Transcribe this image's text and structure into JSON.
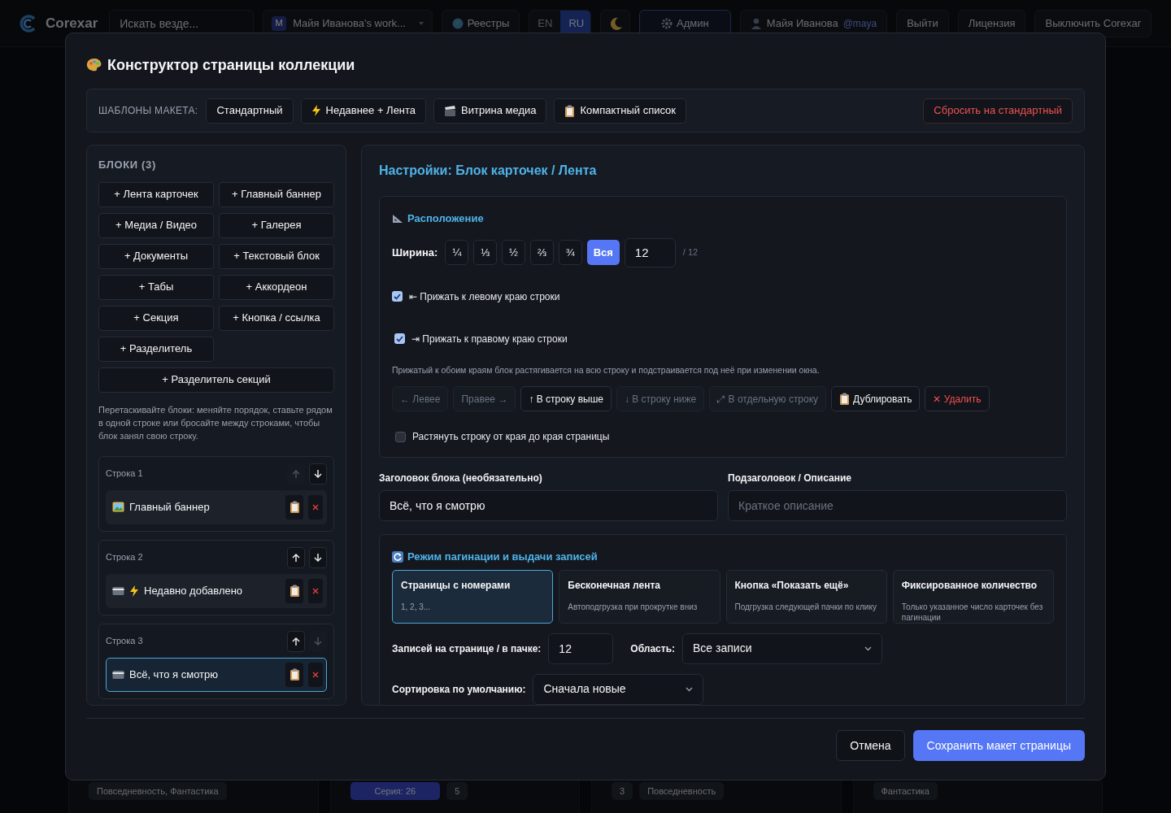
{
  "topbar": {
    "logo": "Corexar",
    "search": {
      "placeholder": "Искать везде..."
    },
    "workspace": {
      "avatar": "M",
      "label": "Майя Иванова's work..."
    },
    "registry": "Реестры",
    "languages": [
      {
        "label": "EN",
        "selected": false
      },
      {
        "label": "RU",
        "selected": true
      }
    ],
    "admin": {
      "label": "Админ",
      "selected": true
    },
    "user": {
      "name": "Майя Иванова",
      "handle": "@maya"
    },
    "buttons": [
      "Выйти",
      "Лицензия",
      "Выключить Corexar"
    ]
  },
  "background_cards": [
    {
      "tags": [
        {
          "label": "Повседневность, Фантастика",
          "selected": false
        }
      ]
    },
    {
      "tags": [
        {
          "label": "Серия: 26",
          "selected": true
        },
        {
          "label": "5",
          "selected": false
        }
      ]
    },
    {
      "tags": [
        {
          "label": "3",
          "selected": false
        },
        {
          "label": "Повседневность",
          "selected": false
        }
      ]
    },
    {
      "tags": [
        {
          "label": "Фантастика",
          "selected": false
        }
      ]
    }
  ],
  "modal": {
    "title": "Конструктор страницы коллекции",
    "templates": {
      "label": "ШАБЛОНЫ МАКЕТА:",
      "items": [
        {
          "kind": "plain",
          "label": "Стандартный"
        },
        {
          "kind": "bolt",
          "label": "Недавнее + Лента"
        },
        {
          "kind": "clapper",
          "label": "Витрина медиа"
        },
        {
          "kind": "clipboard",
          "label": "Компактный список"
        }
      ],
      "reset": "Сбросить на стандартный"
    },
    "blocks": {
      "title": "БЛОКИ (3)",
      "palette": [
        {
          "label": "+ Лента карточек",
          "kind": "half"
        },
        {
          "label": "+ Главный баннер",
          "kind": "half"
        },
        {
          "label": "+ Медиа / Видео",
          "kind": "half"
        },
        {
          "label": "+ Галерея",
          "kind": "half"
        },
        {
          "label": "+ Документы",
          "kind": "half"
        },
        {
          "label": "+ Текстовый блок",
          "kind": "half"
        },
        {
          "label": "+ Табы",
          "kind": "half"
        },
        {
          "label": "+ Аккордеон",
          "kind": "half"
        },
        {
          "label": "+ Секция",
          "kind": "half"
        },
        {
          "label": "+ Кнопка / ссылка",
          "kind": "half"
        },
        {
          "label": "+ Разделитель",
          "kind": "half"
        },
        {
          "label": "+ Разделитель секций",
          "kind": "wide"
        }
      ],
      "hint": "Перетаскивайте блоки: меняйте порядок, ставьте рядом в одной строке или бросайте между строками, чтобы блок занял свою строку.",
      "rows": [
        {
          "label": "Строка 1",
          "up_disabled": true,
          "down_disabled": false,
          "blocks": [
            {
              "kind": "banner",
              "label": "Главный баннер",
              "selected": false
            }
          ]
        },
        {
          "label": "Строка 2",
          "up_disabled": false,
          "down_disabled": false,
          "blocks": [
            {
              "kind": "recent",
              "label": "Недавно добавлено",
              "selected": false
            }
          ]
        },
        {
          "label": "Строка 3",
          "up_disabled": false,
          "down_disabled": true,
          "blocks": [
            {
              "kind": "feed",
              "label": "Всё, что я смотрю",
              "selected": true
            }
          ]
        }
      ]
    },
    "settings": {
      "title": "Настройки: Блок карточек / Лента",
      "layout": {
        "heading": "Расположение",
        "width_label": "Ширина:",
        "width_options": [
          {
            "label": "¼",
            "selected": false
          },
          {
            "label": "⅓",
            "selected": false
          },
          {
            "label": "½",
            "selected": false
          },
          {
            "label": "⅔",
            "selected": false
          },
          {
            "label": "¾",
            "selected": false
          },
          {
            "label": "Вся",
            "selected": true
          }
        ],
        "width_value": "12",
        "width_suffix": "/ 12",
        "pins": [
          {
            "label": "⇤ Прижать к левому краю строки",
            "checked": true
          },
          {
            "label": "⇥ Прижать к правому краю строки",
            "checked": true
          }
        ],
        "pin_hint": "Прижатый к обоим краям блок растягивается на всю строку и подстраивается под неё при изменении окна.",
        "actions": [
          {
            "kind": "normal",
            "label": "← Левее",
            "disabled": true
          },
          {
            "kind": "normal",
            "label": "Правее →",
            "disabled": true
          },
          {
            "kind": "normal",
            "label": "↑ В строку выше",
            "disabled": false
          },
          {
            "kind": "normal",
            "label": "↓ В строку ниже",
            "disabled": true
          },
          {
            "kind": "normal",
            "label": "⤢ В отдельную строку",
            "disabled": true
          },
          {
            "kind": "copy",
            "label": "Дублировать",
            "disabled": false
          },
          {
            "kind": "danger",
            "label": "✕ Удалить",
            "disabled": false
          }
        ],
        "stretch": {
          "label": "Растянуть строку от края до края страницы",
          "checked": false
        }
      },
      "title_field": {
        "label": "Заголовок блока (необязательно)",
        "value": "Всё, что я смотрю"
      },
      "subtitle_field": {
        "label": "Подзаголовок / Описание",
        "placeholder": "Краткое описание"
      },
      "pagination": {
        "heading": "Режим пагинации и выдачи записей",
        "modes": [
          {
            "title": "Страницы с номерами",
            "description": "1, 2, 3...",
            "selected": true
          },
          {
            "title": "Бесконечная лента",
            "description": "Автоподгрузка при прокрутке вниз",
            "selected": false
          },
          {
            "title": "Кнопка «Показать ещё»",
            "description": "Подгрузка следующей пачки по клику",
            "selected": false
          },
          {
            "title": "Фиксированное количество",
            "description": "Только указанное число карточек без пагинации",
            "selected": false
          }
        ],
        "per_page_label": "Записей на странице / в пачке:",
        "per_page_value": "12",
        "scope_label": "Область:",
        "scope_value": "Все записи",
        "sort_label": "Сортировка по умолчанию:",
        "sort_value": "Сначала новые"
      }
    },
    "footer": {
      "cancel": "Отмена",
      "save": "Сохранить макет страницы"
    }
  }
}
